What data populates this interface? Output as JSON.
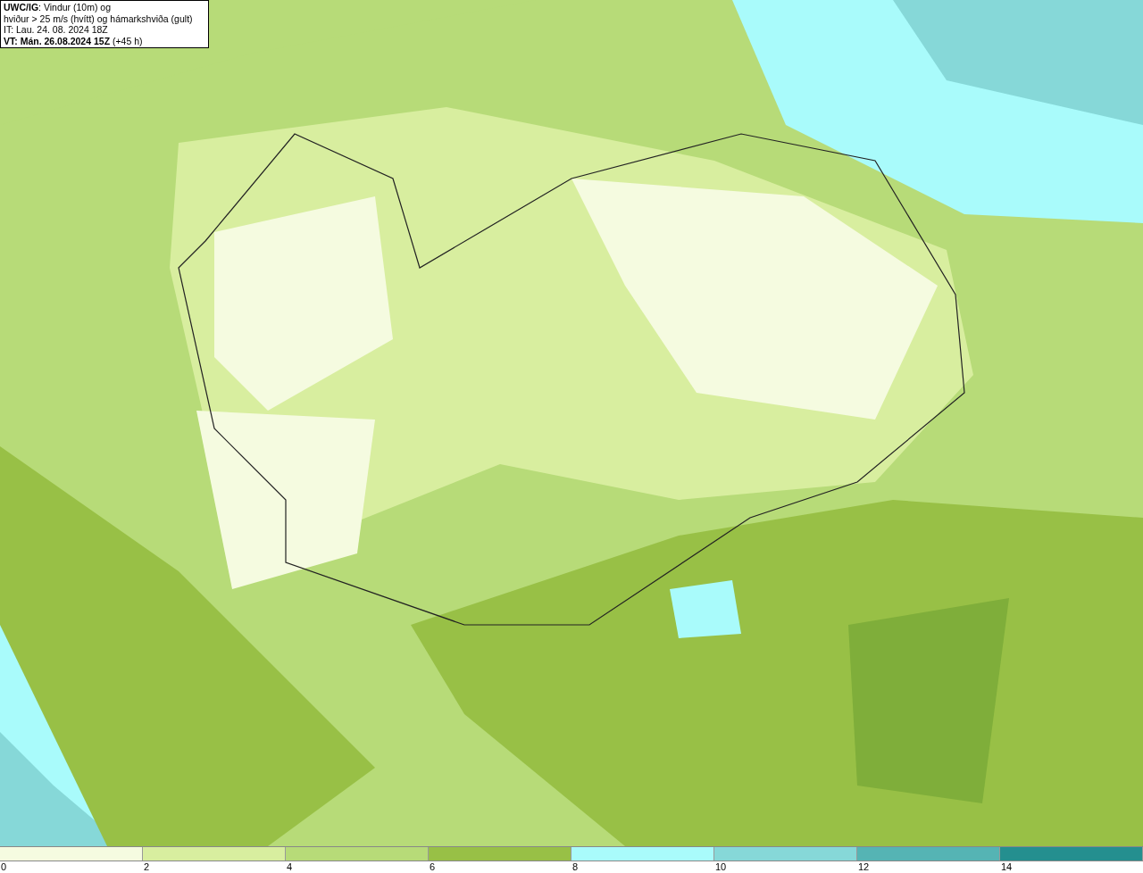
{
  "legend": {
    "lines": [
      "**UWC/IG**: Vindur (10m) og",
      "hviður > 25 m/s (hvítt) og hámarkshviða (gult)",
      "IT: Lau. 24. 08. 2024 18Z",
      "**VT: Mán. 26.08.2024 15Z** (+45 h)"
    ]
  },
  "colorbar": {
    "segments": [
      {
        "color": "#f5fbe0"
      },
      {
        "color": "#d8ee9f"
      },
      {
        "color": "#b7db78"
      },
      {
        "color": "#98c046"
      },
      {
        "color": "#a9fbfb"
      },
      {
        "color": "#86d8d8"
      },
      {
        "color": "#55b4b4"
      },
      {
        "color": "#248f8f"
      }
    ],
    "ticks": [
      "0",
      "2",
      "4",
      "6",
      "8",
      "10",
      "12",
      "14"
    ]
  }
}
